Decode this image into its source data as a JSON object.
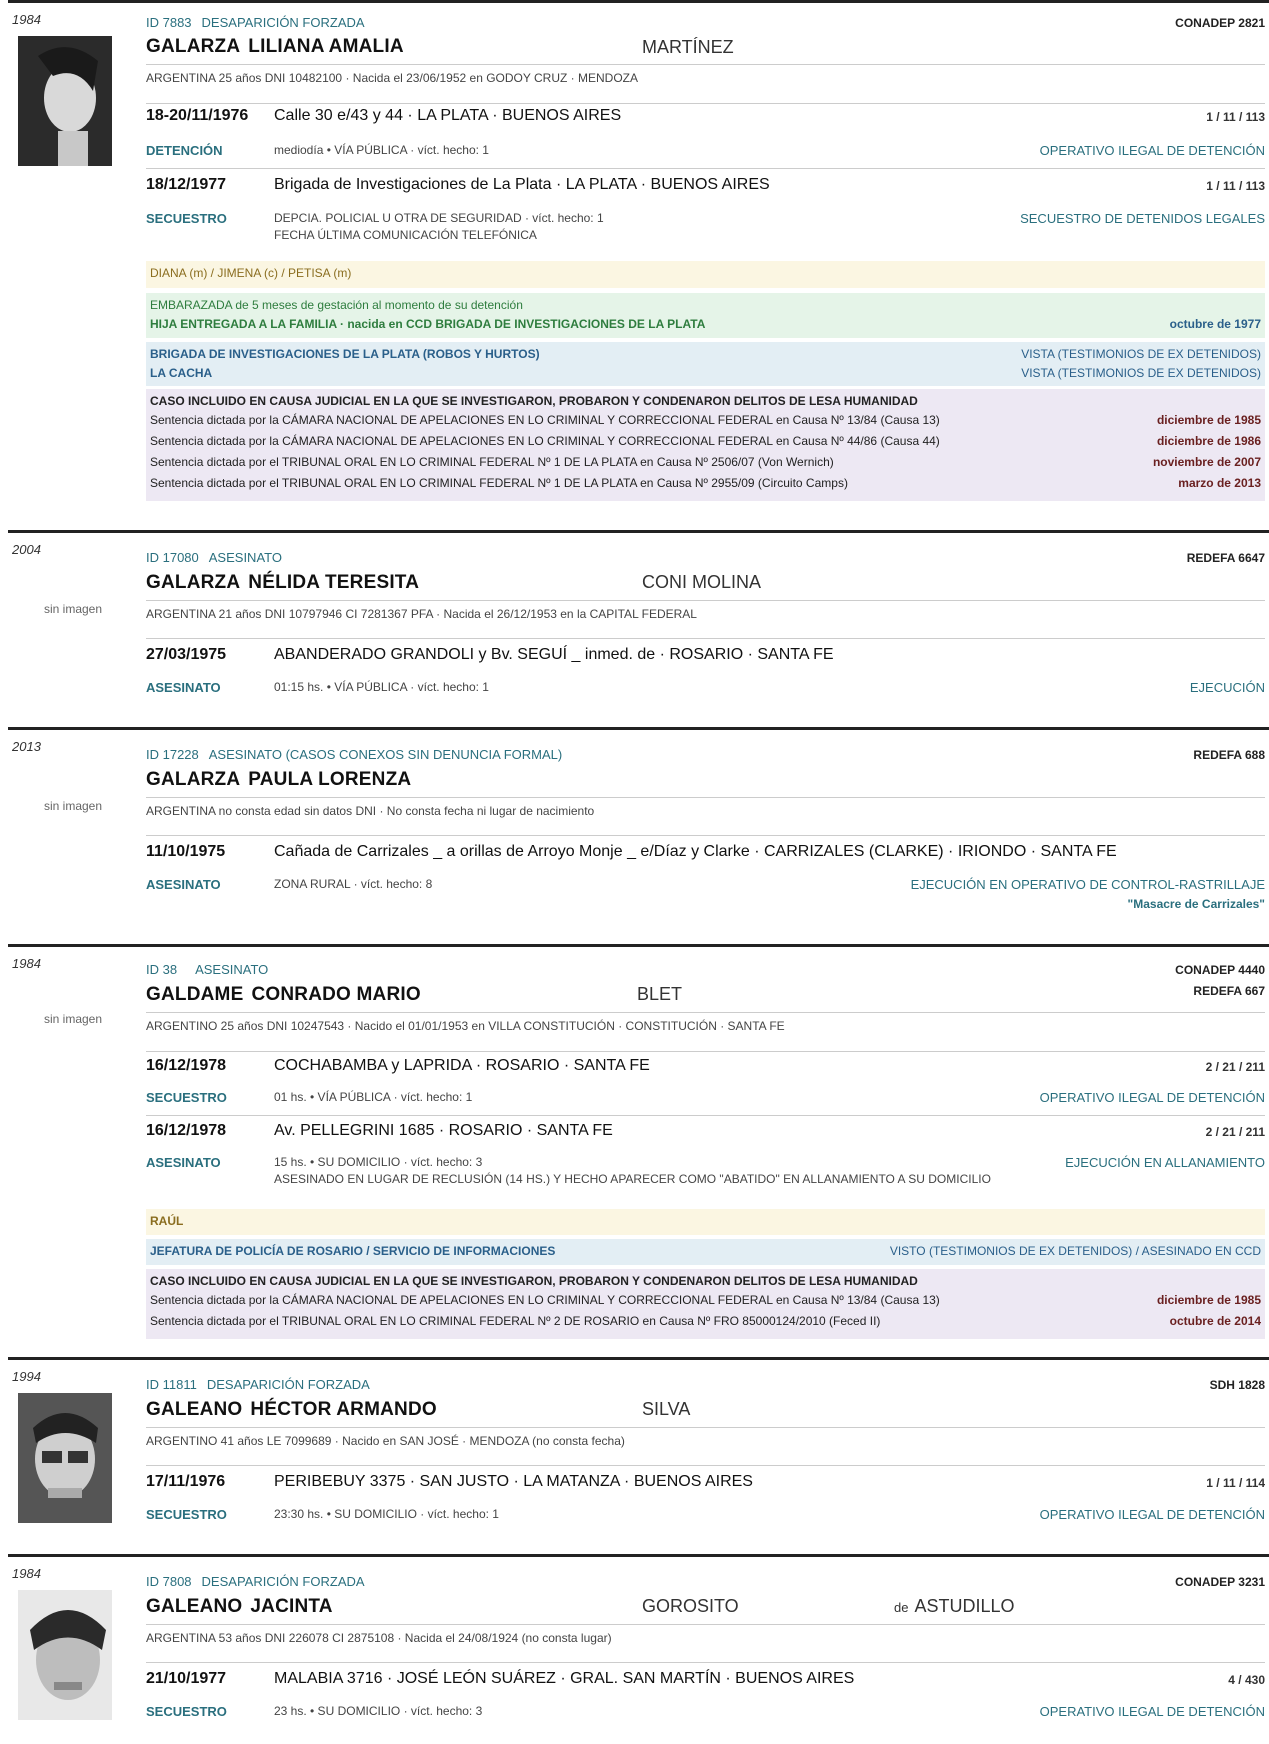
{
  "records": [
    {
      "year": "1984",
      "id": "ID 7883",
      "type": "DESAPARICIÓN FORZADA",
      "sources": [
        "CONADEP  2821"
      ],
      "surname": "GALARZA",
      "given": "LILIANA AMALIA",
      "maternal": "MARTÍNEZ",
      "meta": "ARGENTINA   25 años   DNI 10482100  ·  Nacida el 23/06/1952 en GODOY CRUZ · MENDOZA",
      "events": [
        {
          "date": "18-20/11/1976",
          "place": "Calle 30 e/43 y 44   ·   LA PLATA · BUENOS AIRES",
          "code": "1 / 11 / 113",
          "kind": "DETENCIÓN",
          "detail": "mediodía  •  VÍA PÚBLICA  ·  víct. hecho: 1",
          "detail2": "",
          "class": "OPERATIVO ILEGAL DE DETENCIÓN"
        },
        {
          "date": "18/12/1977",
          "place": "Brigada de Investigaciones de La Plata   ·   LA PLATA · BUENOS AIRES",
          "code": "1 / 11 / 113",
          "kind": "SECUESTRO",
          "detail": "DEPCIA. POLICIAL U OTRA DE SEGURIDAD  ·  víct. hecho: 1",
          "detail2": "FECHA ÚLTIMA COMUNICACIÓN TELEFÓNICA",
          "class": "SECUESTRO DE DETENIDOS LEGALES"
        }
      ],
      "alias": "DIANA (m) / JIMENA (c) / PETISA (m)",
      "pregnancy": {
        "line1": "EMBARAZADA de 5 meses de gestación al momento de su detención",
        "line2": "HIJA ENTREGADA A LA FAMILIA · nacida en CCD BRIGADA DE INVESTIGACIONES DE LA PLATA",
        "date": "octubre de 1977"
      },
      "ccd": [
        {
          "name": "BRIGADA DE INVESTIGACIONES DE LA PLATA (ROBOS Y HURTOS)",
          "status": "VISTA (TESTIMONIOS DE EX DETENIDOS)"
        },
        {
          "name": "LA CACHA",
          "status": "VISTA (TESTIMONIOS DE EX DETENIDOS)"
        }
      ],
      "causa_title": "CASO INCLUIDO EN CAUSA JUDICIAL EN LA QUE SE INVESTIGARON, PROBARON Y CONDENARON DELITOS DE LESA HUMANIDAD",
      "sentences": [
        {
          "text": "Sentencia dictada por la CÁMARA NACIONAL DE APELACIONES EN LO CRIMINAL Y CORRECCIONAL FEDERAL en Causa Nº 13/84 (Causa 13)",
          "date": "diciembre de 1985"
        },
        {
          "text": "Sentencia dictada por la CÁMARA NACIONAL DE APELACIONES EN LO CRIMINAL Y CORRECCIONAL FEDERAL en Causa Nº 44/86 (Causa 44)",
          "date": "diciembre de 1986"
        },
        {
          "text": "Sentencia dictada por el TRIBUNAL ORAL EN LO CRIMINAL FEDERAL Nº 1 DE LA PLATA en Causa Nº 2506/07 (Von Wernich)",
          "date": "noviembre de 2007"
        },
        {
          "text": "Sentencia dictada por el TRIBUNAL ORAL EN LO CRIMINAL FEDERAL Nº 1 DE LA PLATA en Causa Nº 2955/09 (Circuito Camps)",
          "date": "marzo de 2013"
        }
      ]
    },
    {
      "year": "2004",
      "id": "ID 17080",
      "type": "ASESINATO",
      "sources": [
        "REDEFA  6647"
      ],
      "surname": "GALARZA",
      "given": "NÉLIDA TERESITA",
      "maternal": "CONI MOLINA",
      "no_image": "sin imagen",
      "meta": "ARGENTINA   21 años   DNI 10797946   CI 7281367 PFA  ·  Nacida el 26/12/1953 en la CAPITAL FEDERAL",
      "events": [
        {
          "date": "27/03/1975",
          "place": "ABANDERADO GRANDOLI y Bv. SEGUÍ _ inmed. de   ·   ROSARIO · SANTA FE",
          "code": "",
          "kind": "ASESINATO",
          "detail": "01:15 hs.  •  VÍA PÚBLICA  ·  víct. hecho: 1",
          "class": "EJECUCIÓN"
        }
      ]
    },
    {
      "year": "2013",
      "id": "ID 17228",
      "type": "ASESINATO (CASOS CONEXOS SIN DENUNCIA FORMAL)",
      "sources": [
        "REDEFA  688"
      ],
      "surname": "GALARZA",
      "given": "PAULA LORENZA",
      "no_image": "sin imagen",
      "meta": "ARGENTINA   no consta edad   sin datos DNI  ·  No consta fecha ni lugar de nacimiento",
      "events": [
        {
          "date": "11/10/1975",
          "place": "Cañada de Carrizales _ a orillas de Arroyo Monje _ e/Díaz y Clarke   ·   CARRIZALES (CLARKE) · IRIONDO · SANTA FE",
          "code": "",
          "kind": "ASESINATO",
          "detail": "ZONA RURAL  ·  víct. hecho: 8",
          "class": "EJECUCIÓN EN OPERATIVO DE CONTROL-RASTRILLAJE",
          "class2": "\"Masacre de Carrizales\""
        }
      ]
    },
    {
      "year": "1984",
      "id": "ID 38",
      "type": "ASESINATO",
      "sources": [
        "CONADEP  4440",
        "REDEFA  667"
      ],
      "surname": "GALDAME",
      "given": "CONRADO MARIO",
      "maternal": "BLET",
      "no_image": "sin imagen",
      "meta": "ARGENTINO   25 años   DNI 10247543  ·  Nacido el 01/01/1953 en VILLA CONSTITUCIÓN · CONSTITUCIÓN · SANTA FE",
      "events": [
        {
          "date": "16/12/1978",
          "place": "COCHABAMBA y LAPRIDA   ·   ROSARIO · SANTA FE",
          "code": "2 / 21 / 211",
          "kind": "SECUESTRO",
          "detail": "01 hs.  •  VÍA PÚBLICA  ·  víct. hecho: 1",
          "detail2": "",
          "class": "OPERATIVO ILEGAL DE DETENCIÓN"
        },
        {
          "date": "16/12/1978",
          "place": "Av. PELLEGRINI 1685   ·   ROSARIO · SANTA FE",
          "code": "2 / 21 / 211",
          "kind": "ASESINATO",
          "detail": "15 hs.  •  SU DOMICILIO  ·  víct. hecho: 3",
          "detail2": "ASESINADO EN LUGAR DE RECLUSIÓN (14 HS.) Y HECHO APARECER COMO \"ABATIDO\" EN ALLANAMIENTO A SU DOMICILIO",
          "class": "EJECUCIÓN EN ALLANAMIENTO"
        }
      ],
      "alias": "RAÚL",
      "ccd": [
        {
          "name": "JEFATURA DE POLICÍA DE ROSARIO / SERVICIO DE INFORMACIONES",
          "status": "VISTO (TESTIMONIOS DE EX DETENIDOS) / ASESINADO EN CCD"
        }
      ],
      "causa_title": "CASO INCLUIDO EN CAUSA JUDICIAL EN LA QUE SE INVESTIGARON, PROBARON Y CONDENARON DELITOS DE LESA HUMANIDAD",
      "sentences": [
        {
          "text": "Sentencia dictada por la CÁMARA NACIONAL DE APELACIONES EN LO CRIMINAL Y CORRECCIONAL FEDERAL en Causa Nº 13/84 (Causa 13)",
          "date": "diciembre de 1985"
        },
        {
          "text": "Sentencia dictada por el TRIBUNAL ORAL EN LO CRIMINAL FEDERAL Nº 2 DE ROSARIO en Causa Nº FRO 85000124/2010 (Feced II)",
          "date": "octubre de 2014"
        }
      ]
    },
    {
      "year": "1994",
      "id": "ID 11811",
      "type": "DESAPARICIÓN FORZADA",
      "sources": [
        "SDH  1828"
      ],
      "surname": "GALEANO",
      "given": "HÉCTOR ARMANDO",
      "maternal": "SILVA",
      "meta": "ARGENTINO   41 años   LE 7099689  ·  Nacido en SAN JOSÉ · MENDOZA (no consta fecha)",
      "events": [
        {
          "date": "17/11/1976",
          "place": "PERIBEBUY 3375   ·   SAN JUSTO · LA MATANZA · BUENOS AIRES",
          "code": "1 / 11 / 114",
          "kind": "SECUESTRO",
          "detail": "23:30 hs.  •  SU DOMICILIO  ·  víct. hecho: 1",
          "class": "OPERATIVO ILEGAL DE DETENCIÓN"
        }
      ]
    },
    {
      "year": "1984",
      "id": "ID 7808",
      "type": "DESAPARICIÓN FORZADA",
      "sources": [
        "CONADEP  3231"
      ],
      "surname": "GALEANO",
      "given": "JACINTA",
      "maternal": "GOROSITO",
      "married_prefix": "de",
      "married": "ASTUDILLO",
      "meta": "ARGENTINA   53 años   DNI 226078   CI 2875108  ·  Nacida el 24/08/1924 (no consta lugar)",
      "events": [
        {
          "date": "21/10/1977",
          "place": "MALABIA 3716   ·   JOSÉ LEÓN SUÁREZ · GRAL. SAN MARTÍN · BUENOS AIRES",
          "code": "4 / 430",
          "kind": "SECUESTRO",
          "detail": "23 hs.  •  SU DOMICILIO  ·  víct. hecho: 3",
          "class": "OPERATIVO ILEGAL DE DETENCIÓN"
        }
      ]
    }
  ]
}
